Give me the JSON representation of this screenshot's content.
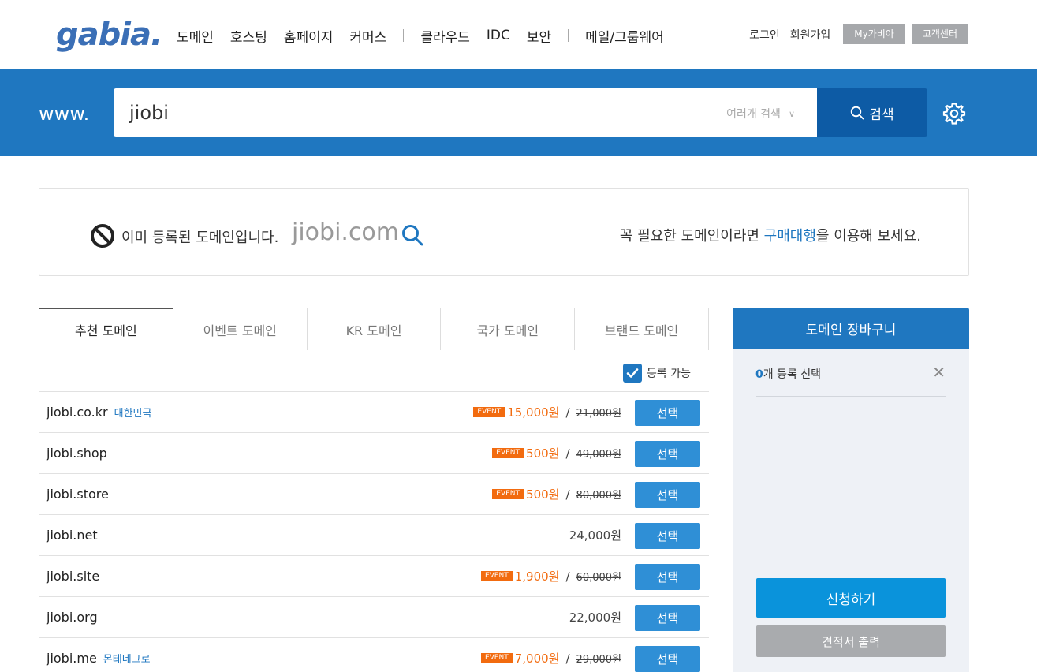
{
  "header": {
    "logo": "gabia.",
    "nav": [
      "도메인",
      "호스팅",
      "홈페이지",
      "커머스",
      "클라우드",
      "IDC",
      "보안",
      "메일/그룹웨어"
    ],
    "util": {
      "login": "로그인",
      "signup": "회원가입",
      "my": "My가비아",
      "support": "고객센터"
    }
  },
  "search": {
    "prefix": "www.",
    "value": "jiobi",
    "multi_label": "여러개 검색",
    "button_label": "검색"
  },
  "notice": {
    "taken_text": "이미 등록된 도메인입니다.",
    "domain": "jiobi.com",
    "tip_before": "꼭 필요한 도메인이라면 ",
    "tip_link": "구매대행",
    "tip_after": "을 이용해 보세요."
  },
  "tabs": [
    "추천 도메인",
    "이벤트 도메인",
    "KR 도메인",
    "국가 도메인",
    "브랜드 도메인"
  ],
  "filter": {
    "available_label": "등록 가능",
    "checked": true
  },
  "domains": [
    {
      "name": "jiobi.co.kr",
      "country": "대한민국",
      "event": "EVENT",
      "sale": "15,000원",
      "original": "21,000원",
      "button": "선택"
    },
    {
      "name": "jiobi.shop",
      "country": "",
      "event": "EVENT",
      "sale": "500원",
      "original": "49,000원",
      "button": "선택"
    },
    {
      "name": "jiobi.store",
      "country": "",
      "event": "EVENT",
      "sale": "500원",
      "original": "80,000원",
      "button": "선택"
    },
    {
      "name": "jiobi.net",
      "country": "",
      "event": "",
      "price": "24,000원",
      "button": "선택"
    },
    {
      "name": "jiobi.site",
      "country": "",
      "event": "EVENT",
      "sale": "1,900원",
      "original": "60,000원",
      "button": "선택"
    },
    {
      "name": "jiobi.org",
      "country": "",
      "event": "",
      "price": "22,000원",
      "button": "선택"
    },
    {
      "name": "jiobi.me",
      "country": "몬테네그로",
      "event": "EVENT",
      "sale": "7,000원",
      "original": "29,000원",
      "button": "선택"
    }
  ],
  "cart": {
    "title": "도메인 장바구니",
    "count": "0",
    "count_suffix": "개 등록 선택",
    "apply_label": "신청하기",
    "quote_label": "견적서 출력"
  },
  "colors": {
    "brand_blue": "#1f77c0",
    "dark_blue": "#0d5ba5",
    "event_orange": "#f26b0f"
  }
}
